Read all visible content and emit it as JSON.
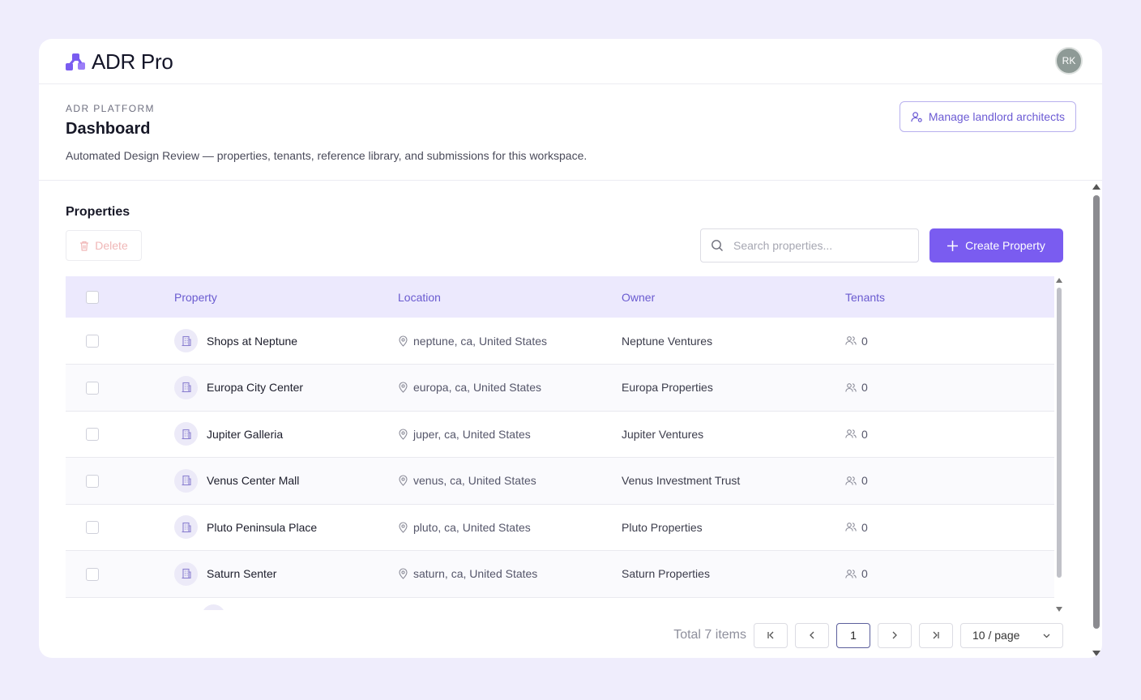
{
  "app": {
    "name": "ADR Pro",
    "logo_icon": "brand-logo-icon"
  },
  "user": {
    "initials": "RK"
  },
  "header": {
    "eyebrow": "ADR PLATFORM",
    "title": "Dashboard",
    "subtitle": "Automated Design Review — properties, tenants, reference library, and submissions for this workspace.",
    "manage_label": "Manage landlord architects"
  },
  "properties": {
    "title": "Properties",
    "delete_label": "Delete",
    "search_placeholder": "Search properties...",
    "create_label": "Create Property",
    "columns": {
      "property": "Property",
      "location": "Location",
      "owner": "Owner",
      "tenants": "Tenants"
    },
    "rows": [
      {
        "name": "Shops at Neptune",
        "location": "neptune, ca, United States",
        "owner": "Neptune Ventures",
        "tenants": "0"
      },
      {
        "name": "Europa City Center",
        "location": "europa, ca, United States",
        "owner": "Europa Properties",
        "tenants": "0"
      },
      {
        "name": "Jupiter Galleria",
        "location": "juper, ca, United States",
        "owner": "Jupiter Ventures",
        "tenants": "0"
      },
      {
        "name": "Venus Center Mall",
        "location": "venus, ca, United States",
        "owner": "Venus Investment Trust",
        "tenants": "0"
      },
      {
        "name": "Pluto Peninsula Place",
        "location": "pluto, ca, United States",
        "owner": "Pluto Properties",
        "tenants": "0"
      },
      {
        "name": "Saturn Senter",
        "location": "saturn, ca, United States",
        "owner": "Saturn Properties",
        "tenants": "0"
      }
    ]
  },
  "pagination": {
    "total_label": "Total 7 items",
    "current_page": "1",
    "page_size": "10 / page"
  },
  "colors": {
    "accent": "#7a5cf0",
    "background": "#efedfc",
    "header_row": "#ece9fd"
  }
}
